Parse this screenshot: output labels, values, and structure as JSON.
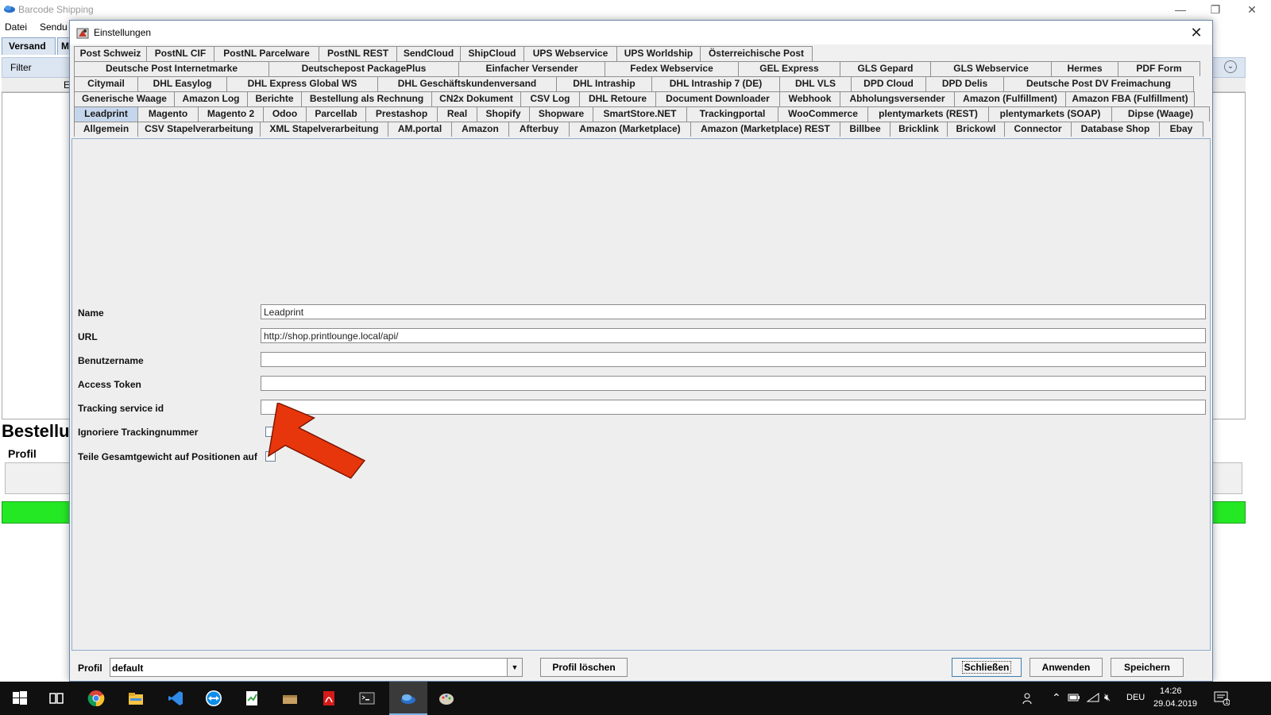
{
  "main_window": {
    "title": "Barcode Shipping",
    "menu": [
      "Datei",
      "Sendu"
    ],
    "tabs": [
      "Versand",
      "M"
    ],
    "filter_label": "Filter",
    "column_fragment": "E",
    "heading": "Bestellu",
    "profil_label": "Profil",
    "window_controls": {
      "minimize": "—",
      "restore": "❐",
      "close": "✕"
    }
  },
  "dialog": {
    "title": "Einstellungen",
    "close_glyph": "✕",
    "tab_rows": [
      [
        "Post Schweiz",
        "PostNL CIF",
        "PostNL Parcelware",
        "PostNL REST",
        "SendCloud",
        "ShipCloud",
        "UPS Webservice",
        "UPS Worldship",
        "Österreichische Post"
      ],
      [
        "Deutsche Post Internetmarke",
        "Deutschepost PackagePlus",
        "Einfacher Versender",
        "Fedex Webservice",
        "GEL Express",
        "GLS Gepard",
        "GLS Webservice",
        "Hermes",
        "PDF Form"
      ],
      [
        "Citymail",
        "DHL Easylog",
        "DHL Express Global WS",
        "DHL Geschäftskundenversand",
        "DHL Intraship",
        "DHL Intraship 7 (DE)",
        "DHL VLS",
        "DPD Cloud",
        "DPD Delis",
        "Deutsche Post DV Freimachung"
      ],
      [
        "Generische Waage",
        "Amazon Log",
        "Berichte",
        "Bestellung als Rechnung",
        "CN2x Dokument",
        "CSV Log",
        "DHL Retoure",
        "Document Downloader",
        "Webhook",
        "Abholungsversender",
        "Amazon (Fulfillment)",
        "Amazon FBA (Fulfillment)"
      ],
      [
        "Leadprint",
        "Magento",
        "Magento 2",
        "Odoo",
        "Parcellab",
        "Prestashop",
        "Real",
        "Shopify",
        "Shopware",
        "SmartStore.NET",
        "Trackingportal",
        "WooCommerce",
        "plentymarkets (REST)",
        "plentymarkets (SOAP)",
        "Dipse (Waage)"
      ],
      [
        "Allgemein",
        "CSV Stapelverarbeitung",
        "XML Stapelverarbeitung",
        "AM.portal",
        "Amazon",
        "Afterbuy",
        "Amazon (Marketplace)",
        "Amazon (Marketplace) REST",
        "Billbee",
        "Bricklink",
        "Brickowl",
        "Connector",
        "Database Shop",
        "Ebay"
      ]
    ],
    "active_tab": "Leadprint",
    "form": {
      "name_label": "Name",
      "name_value": "Leadprint",
      "url_label": "URL",
      "url_value": "http://shop.printlounge.local/api/",
      "benutzername_label": "Benutzername",
      "benutzername_value": "",
      "access_token_label": "Access Token",
      "access_token_value": "",
      "tracking_service_id_label": "Tracking service id",
      "tracking_service_id_value": "",
      "ignoriere_label": "Ignoriere Trackingnummer",
      "ignoriere_checked": false,
      "teile_label": "Teile Gesamtgewicht auf Positionen auf",
      "teile_checked": false
    },
    "footer": {
      "profil_label": "Profil",
      "profil_value": "default",
      "dropdown_glyph": "▼",
      "profil_loeschen": "Profil löschen",
      "schliessen": "Schließen",
      "anwenden": "Anwenden",
      "speichern": "Speichern"
    },
    "annotation_arrow_color": "#e8360c"
  },
  "taskbar": {
    "icons": [
      "windows-start-icon",
      "task-view-icon",
      "chrome-icon",
      "file-explorer-icon",
      "vscode-icon",
      "teamviewer-icon",
      "notepad-icon",
      "package-icon",
      "pdf-reader-icon",
      "terminal-icon",
      "barcode-shipping-icon",
      "paint-icon"
    ],
    "language": "DEU",
    "time": "14:26",
    "date": "29.04.2019",
    "notification_count": "1"
  }
}
